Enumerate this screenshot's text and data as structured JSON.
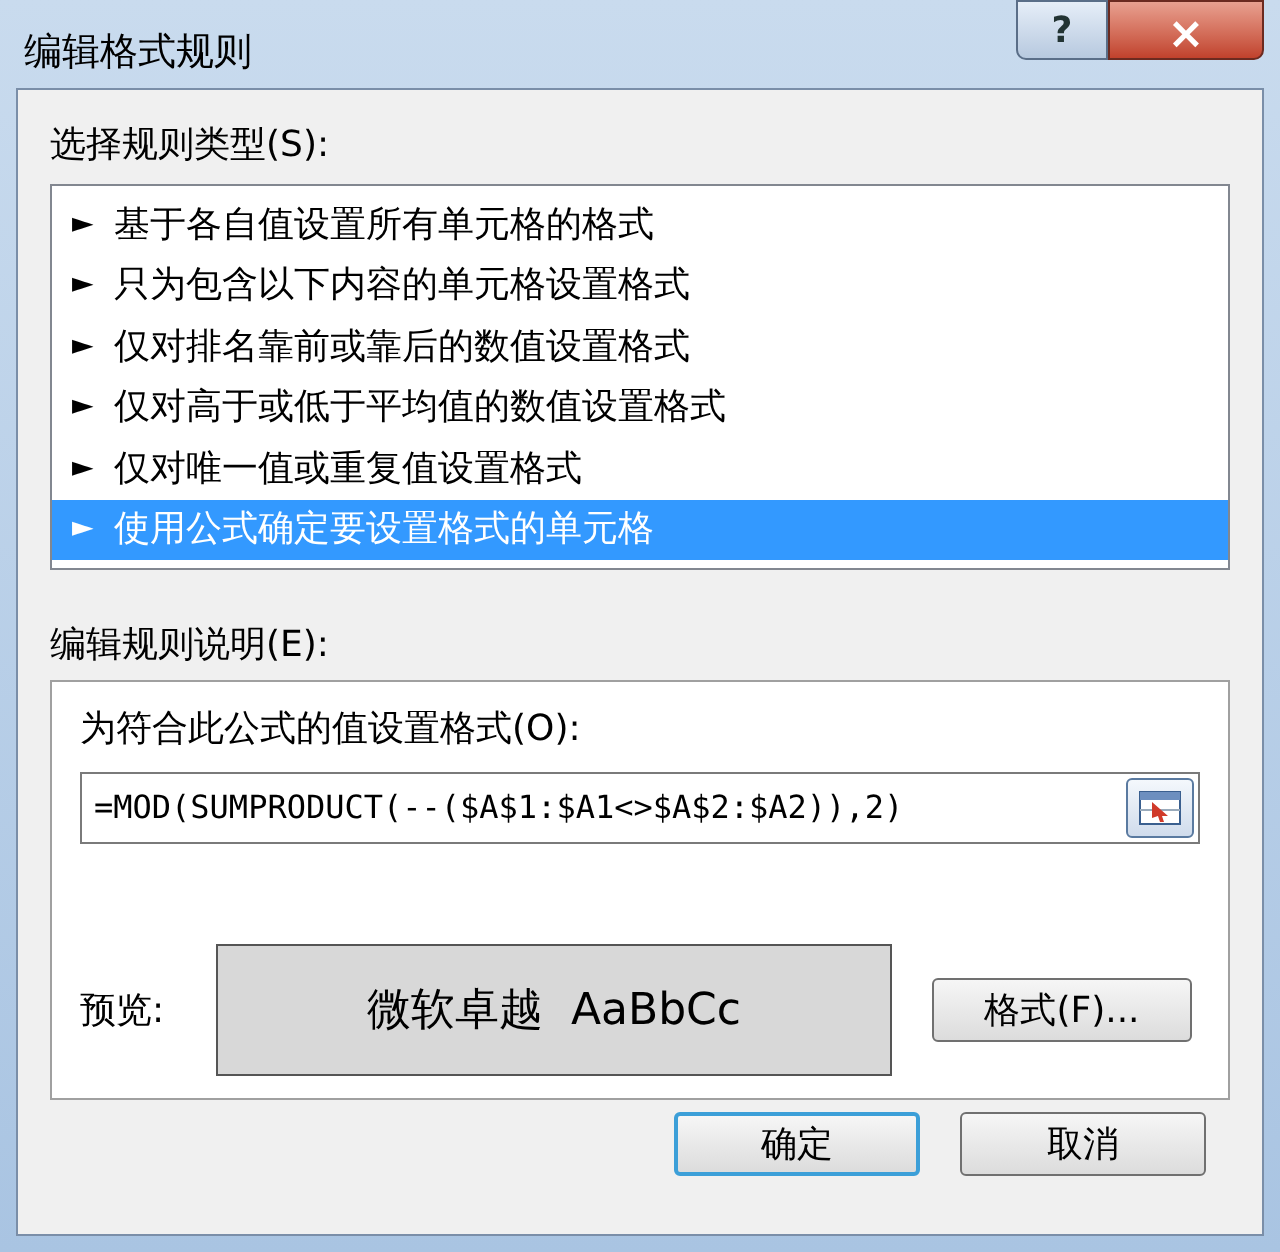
{
  "window": {
    "title": "编辑格式规则",
    "help_button": "?",
    "close_button": "×"
  },
  "rule_type": {
    "label": "选择规则类型(S):",
    "items": [
      {
        "marker": "►",
        "label": "基于各自值设置所有单元格的格式",
        "selected": false
      },
      {
        "marker": "►",
        "label": "只为包含以下内容的单元格设置格式",
        "selected": false
      },
      {
        "marker": "►",
        "label": "仅对排名靠前或靠后的数值设置格式",
        "selected": false
      },
      {
        "marker": "►",
        "label": "仅对高于或低于平均值的数值设置格式",
        "selected": false
      },
      {
        "marker": "►",
        "label": "仅对唯一值或重复值设置格式",
        "selected": false
      },
      {
        "marker": "►",
        "label": "使用公式确定要设置格式的单元格",
        "selected": true
      }
    ]
  },
  "description": {
    "label": "编辑规则说明(E):",
    "formula_label": "为符合此公式的值设置格式(O):",
    "formula": "=MOD(SUMPRODUCT(--($A$1:$A1<>$A$2:$A2)),2)",
    "preview_label": "预览:",
    "preview_text": "微软卓越  AaBbCc",
    "format_button": "格式(F)..."
  },
  "buttons": [
    {
      "label": "确定",
      "default": true
    },
    {
      "label": "取消",
      "default": false
    }
  ]
}
